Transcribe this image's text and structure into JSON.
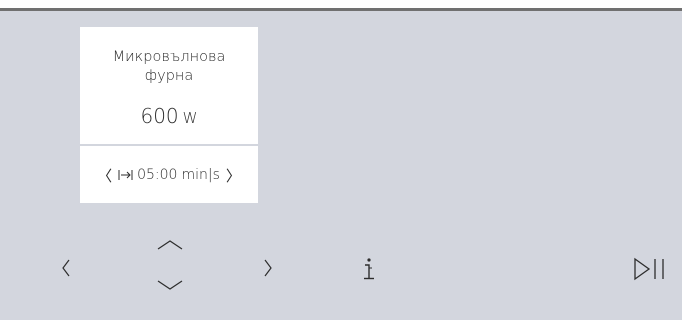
{
  "program_card": {
    "title_line1": "Микровълнова",
    "title_line2": "фурна",
    "power_value": "600",
    "power_unit": "W"
  },
  "time_card": {
    "prev_symbol": "〈",
    "duration_value": "05:00",
    "duration_unit": "min|s",
    "next_symbol": "〉"
  },
  "controls": {
    "left_icon": "chevron-left-icon",
    "up_icon": "chevron-up-icon",
    "down_icon": "chevron-down-icon",
    "right_icon": "chevron-right-icon",
    "info_icon": "info-icon",
    "play_pause_icon": "play-pause-icon"
  },
  "colors": {
    "background": "#d3d6de",
    "card": "#ffffff",
    "text": "#2d2d2d",
    "top_line": "#707070"
  }
}
